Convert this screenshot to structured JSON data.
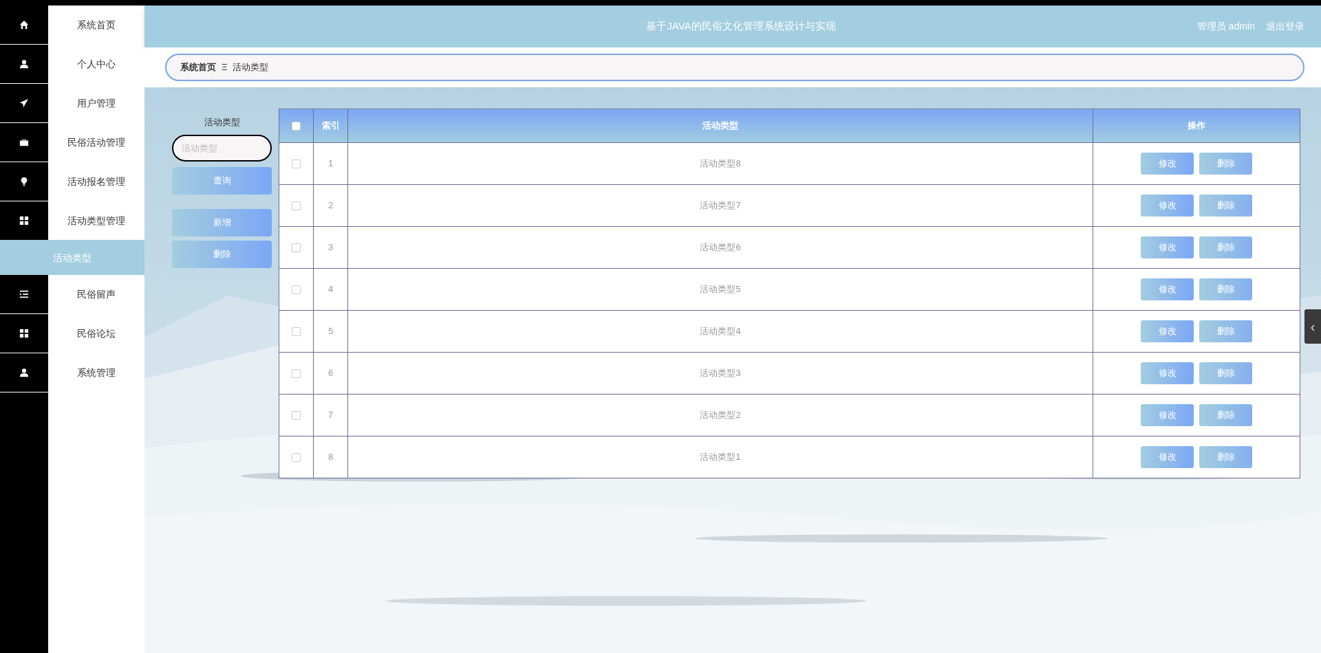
{
  "sidebar": {
    "items": [
      {
        "label": "系统首页",
        "selected": false
      },
      {
        "label": "个人中心",
        "selected": false
      },
      {
        "label": "用户管理",
        "selected": false
      },
      {
        "label": "民俗活动管理",
        "selected": false
      },
      {
        "label": "活动报名管理",
        "selected": false
      },
      {
        "label": "活动类型管理",
        "selected": false,
        "expanded": true,
        "children": [
          {
            "label": "活动类型",
            "selected": true
          }
        ]
      },
      {
        "label": "民俗留声",
        "selected": false
      },
      {
        "label": "民俗论坛",
        "selected": false
      },
      {
        "label": "系统管理",
        "selected": false
      }
    ]
  },
  "header": {
    "title": "基于JAVA的民俗文化管理系统设计与实现",
    "user": "管理员 admin",
    "logout": "退出登录"
  },
  "breadcrumb": {
    "items": [
      "系统首页",
      "活动类型"
    ],
    "separator": "Ξ"
  },
  "search": {
    "label": "活动类型",
    "placeholder": "活动类型",
    "buttons": [
      "查询",
      "新增",
      "删除"
    ]
  },
  "table": {
    "select_all": {
      "checked": false
    },
    "columns": [
      "索引",
      "活动类型",
      "操作"
    ],
    "rows": [
      {
        "checked": false,
        "index": "1",
        "name": "活动类型8",
        "actions": [
          "修改",
          "删除"
        ]
      },
      {
        "checked": false,
        "index": "2",
        "name": "活动类型7",
        "actions": [
          "修改",
          "删除"
        ]
      },
      {
        "checked": false,
        "index": "3",
        "name": "活动类型6",
        "actions": [
          "修改",
          "删除"
        ]
      },
      {
        "checked": false,
        "index": "4",
        "name": "活动类型5",
        "actions": [
          "修改",
          "删除"
        ]
      },
      {
        "checked": false,
        "index": "5",
        "name": "活动类型4",
        "actions": [
          "修改",
          "删除"
        ]
      },
      {
        "checked": false,
        "index": "6",
        "name": "活动类型3",
        "actions": [
          "修改",
          "删除"
        ]
      },
      {
        "checked": false,
        "index": "7",
        "name": "活动类型2",
        "actions": [
          "修改",
          "删除"
        ]
      },
      {
        "checked": false,
        "index": "8",
        "name": "活动类型1",
        "actions": [
          "修改",
          "删除"
        ]
      }
    ]
  },
  "side_tab": {
    "glyph": "‹"
  }
}
